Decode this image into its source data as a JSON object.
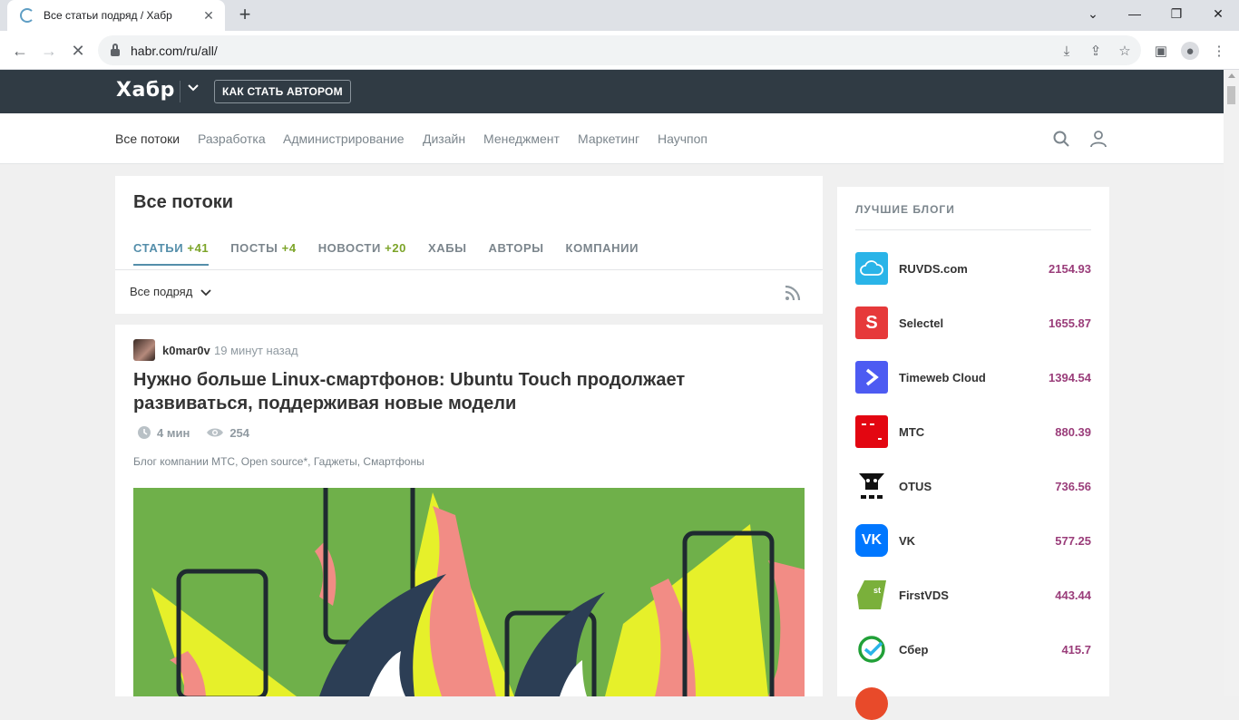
{
  "browser": {
    "tab_title": "Все статьи подряд / Хабр",
    "url": "habr.com/ru/all/"
  },
  "header": {
    "logo": "Хабр",
    "author_button": "КАК СТАТЬ АВТОРОМ"
  },
  "nav": {
    "items": [
      "Все потоки",
      "Разработка",
      "Администрирование",
      "Дизайн",
      "Менеджмент",
      "Маркетинг",
      "Научпоп"
    ]
  },
  "flow": {
    "title": "Все потоки",
    "tabs": [
      {
        "label": "СТАТЬИ",
        "count": "+41"
      },
      {
        "label": "ПОСТЫ",
        "count": "+4"
      },
      {
        "label": "НОВОСТИ",
        "count": "+20"
      },
      {
        "label": "ХАБЫ",
        "count": ""
      },
      {
        "label": "АВТОРЫ",
        "count": ""
      },
      {
        "label": "КОМПАНИИ",
        "count": ""
      }
    ],
    "filter": "Все подряд"
  },
  "article": {
    "author": "k0mar0v",
    "time": "19 минут назад",
    "title": "Нужно больше Linux-смартфонов: Ubuntu Touch продолжает развиваться, поддерживая новые модели",
    "read_time": "4 мин",
    "views": "254",
    "hubs": "Блог компании МТС, Open source*, Гаджеты, Смартфоны"
  },
  "blogs": {
    "heading": "ЛУЧШИЕ БЛОГИ",
    "items": [
      {
        "name": "RUVDS.com",
        "score": "2154.93",
        "color": "#2ab4e8"
      },
      {
        "name": "Selectel",
        "score": "1655.87",
        "color": "#e6393a"
      },
      {
        "name": "Timeweb Cloud",
        "score": "1394.54",
        "color": "#4d5bf2"
      },
      {
        "name": "МТС",
        "score": "880.39",
        "color": "#e30611"
      },
      {
        "name": "OTUS",
        "score": "736.56",
        "color": "#ffffff"
      },
      {
        "name": "VK",
        "score": "577.25",
        "color": "#0077ff"
      },
      {
        "name": "FirstVDS",
        "score": "443.44",
        "color": "#7ab03b"
      },
      {
        "name": "Сбер",
        "score": "415.7",
        "color": "#21a038"
      }
    ]
  }
}
